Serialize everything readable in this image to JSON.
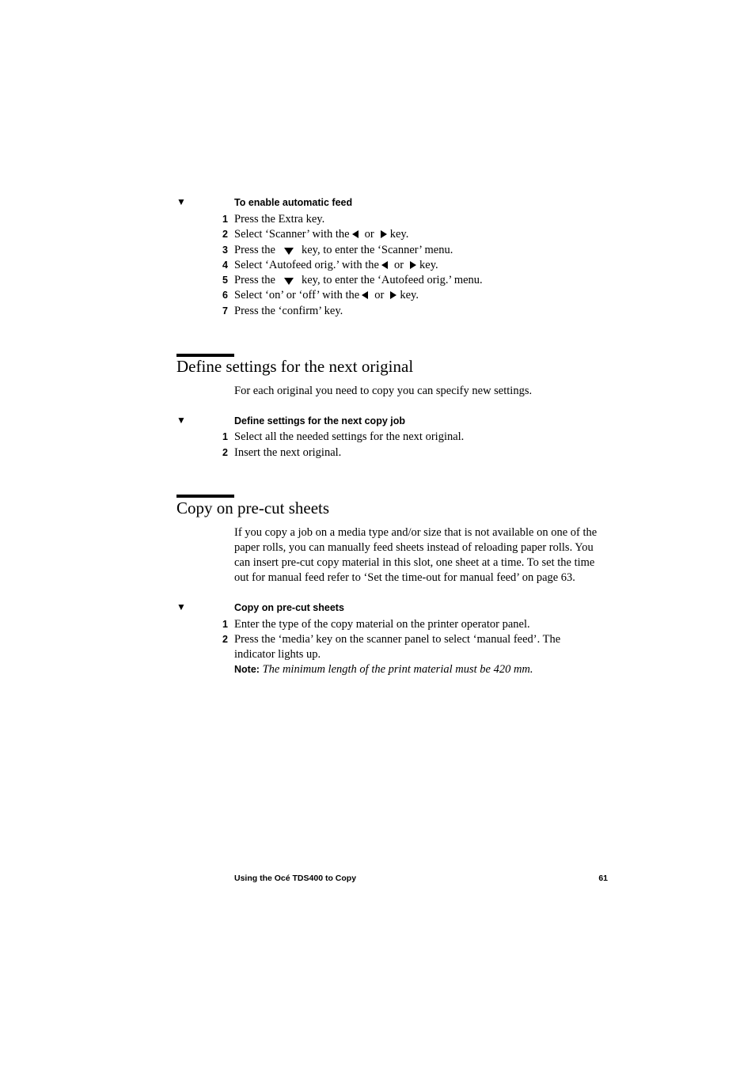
{
  "procedures": [
    {
      "title": "To enable automatic feed",
      "marker": "▼",
      "steps": [
        {
          "num": "1",
          "parts": [
            "Press the Extra key."
          ]
        },
        {
          "num": "2",
          "parts": [
            "Select ‘Scanner’ with the",
            "or",
            "key."
          ]
        },
        {
          "num": "3",
          "parts": [
            "Press the",
            "key, to enter the ‘Scanner’ menu."
          ]
        },
        {
          "num": "4",
          "parts": [
            "Select ‘Autofeed orig.’ with the",
            "or",
            "key."
          ]
        },
        {
          "num": "5",
          "parts": [
            "Press the",
            "key, to enter the ‘Autofeed orig.’ menu."
          ]
        },
        {
          "num": "6",
          "parts": [
            "Select ‘on’ or ‘off’ with the",
            "or",
            "key."
          ]
        },
        {
          "num": "7",
          "parts": [
            "Press the ‘confirm’ key."
          ]
        }
      ]
    },
    {
      "title": "Define settings for the next copy job",
      "marker": "▼",
      "steps": [
        {
          "num": "1",
          "parts": [
            "Select all the needed settings for the next original."
          ]
        },
        {
          "num": "2",
          "parts": [
            "Insert the next original."
          ]
        }
      ]
    },
    {
      "title": "Copy on pre-cut sheets",
      "marker": "▼",
      "steps": [
        {
          "num": "1",
          "parts": [
            "Enter the type of the copy material on the printer operator panel."
          ]
        },
        {
          "num": "2",
          "parts": [
            "Press the ‘media’ key on the scanner panel to select ‘manual feed’. The",
            "indicator lights up."
          ]
        }
      ],
      "note": {
        "label": "Note:",
        "text": "The minimum length of the print material must be 420 mm."
      }
    }
  ],
  "sections": [
    {
      "heading": "Define settings for the next original",
      "body_lines": [
        "For each original you need to copy you can specify new settings."
      ]
    },
    {
      "heading": "Copy on pre-cut sheets",
      "body_lines": [
        "If you copy a job on a media type and/or size that is not available on one of the",
        "paper rolls, you can manually feed sheets instead of reloading paper rolls. You",
        "can insert pre-cut copy material in this slot, one sheet at a time. To set the time",
        "out for manual feed refer to ‘Set the time-out for manual feed’ on page 63."
      ]
    }
  ],
  "footer": {
    "title": "Using the Océ TDS400 to Copy",
    "page_number": "61"
  }
}
